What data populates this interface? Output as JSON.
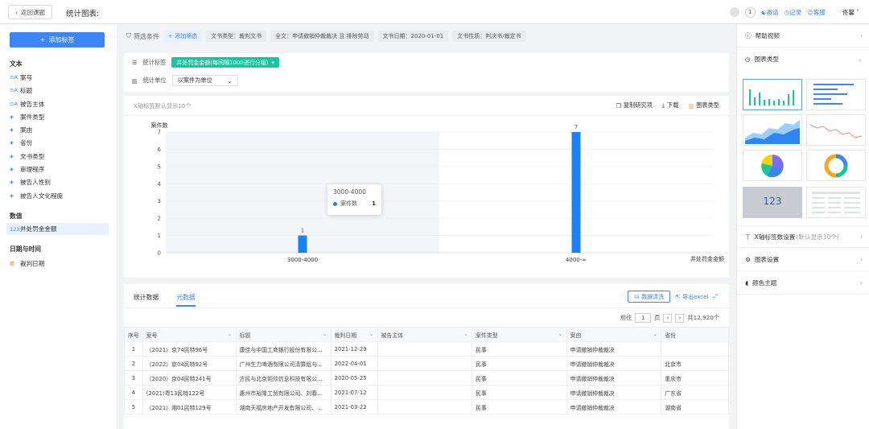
{
  "header": {
    "back_label": "返回课题",
    "title": "统计图表:",
    "notification_count": "1",
    "invite": "邀请",
    "history": "记录",
    "service": "客服",
    "user": "佟馨"
  },
  "sidebar": {
    "add_tag": "添加标签",
    "sections": [
      {
        "title": "文本",
        "items": [
          {
            "label": "案号",
            "icon": "text-icon"
          },
          {
            "label": "标题",
            "icon": "text-icon"
          },
          {
            "label": "被告主体",
            "icon": "text-icon"
          },
          {
            "label": "案件类型",
            "icon": "layers-icon"
          },
          {
            "label": "案由",
            "icon": "layers-icon"
          },
          {
            "label": "省份",
            "icon": "layers-icon"
          },
          {
            "label": "文书类型",
            "icon": "layers-icon"
          },
          {
            "label": "审理程序",
            "icon": "layers-icon"
          },
          {
            "label": "被告人性别",
            "icon": "layers-icon"
          },
          {
            "label": "被告人文化程度",
            "icon": "layers-icon"
          }
        ]
      },
      {
        "title": "数值",
        "items": [
          {
            "label": "并处罚金金额",
            "icon": "number-icon"
          }
        ]
      },
      {
        "title": "日期与时间",
        "items": [
          {
            "label": "裁判日期",
            "icon": "calendar-icon"
          }
        ]
      }
    ]
  },
  "filters": {
    "label": "筛选条件",
    "add": "添加筛选",
    "chips": [
      "文书类型：裁判文书",
      "全文：申请撤销仲裁裁决 且 排除劳动",
      "文书日期：2020-01-01",
      "文书性质：判决书/裁定书"
    ]
  },
  "stats": {
    "tag_label": "统计标签",
    "tag_value": "并处罚金金额(每间隔1000进行分组)",
    "unit_label": "统计单位",
    "unit_value": "以案件为单位"
  },
  "chart_toolbar": {
    "note": "X轴标签默认显示10个",
    "copy": "复制研究项",
    "download": "下载",
    "chart_type": "图表类型"
  },
  "chart_data": {
    "type": "bar",
    "categories": [
      "3000-4000",
      "4000-∞"
    ],
    "series": [
      {
        "name": "案件数",
        "values": [
          1,
          7
        ]
      }
    ],
    "ylabel": "案件数",
    "xlabel": "并处罚金金额",
    "ylim": [
      0,
      7
    ],
    "yticks": [
      0,
      1,
      2,
      3,
      4,
      5,
      6,
      7
    ],
    "bar_color": "#1a82f6",
    "grid": true
  },
  "tooltip": {
    "title": "3000-4000",
    "series": "案件数",
    "value": "1"
  },
  "table_panel": {
    "tabs": [
      "统计数据",
      "元数据"
    ],
    "active_tab": 1,
    "clean_btn": "数据清洗",
    "export_btn": "导出excel",
    "pager": {
      "prev": "前往",
      "page": "1",
      "page_unit": "页",
      "total": "共12,920个"
    },
    "columns": [
      "序号",
      "案号",
      "标题",
      "裁判日期",
      "被告主体",
      "案件类型",
      "案由",
      "省份"
    ],
    "rows": [
      [
        "1",
        "（2021）京74民特96号",
        "康佳与中国工商银行股份有限公...",
        "2021-12-29",
        "",
        "民事",
        "申请撤销仲裁裁决",
        ""
      ],
      [
        "2",
        "（2022）京04民特92号",
        "广州生力啤酒有限公司清算组与...",
        "2022-04-01",
        "",
        "民事",
        "申请撤销仲裁裁决",
        "北京市"
      ],
      [
        "3",
        "（2020）京04民特241号",
        "方民与北京钜欣信息科技有限公...",
        "2020-05-25",
        "",
        "民事",
        "申请撤销仲裁裁决",
        "重庆市"
      ],
      [
        "4",
        "(2021)粤13民特122号",
        "惠州市裕隆工贸有限公司、刘春...",
        "2021-07-12",
        "",
        "民事",
        "申请撤销仲裁裁决",
        "广东省"
      ],
      [
        "5",
        "（2021）湘01民特129号",
        "湖南天福房地产开发有限公司、...",
        "2021-03-22",
        "",
        "民事",
        "申请撤销仲裁裁决",
        "湖南省"
      ]
    ]
  },
  "right_panel": {
    "help": "帮助视频",
    "chart_type": "图表类型",
    "thumb_number": "123",
    "xaxis_setting": "X轴标签数设置",
    "xaxis_hint": "(默认显示10个)",
    "chart_settings": "图表设置",
    "color_theme": "颜色主题"
  }
}
